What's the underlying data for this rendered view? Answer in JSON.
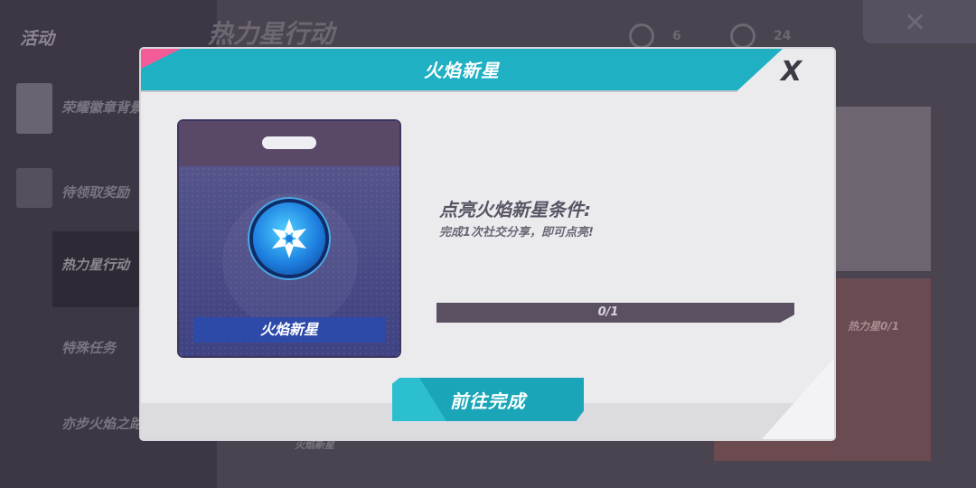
{
  "background": {
    "sidebar_title": "活动",
    "nav_items": [
      {
        "label": "荣耀徽章背景"
      },
      {
        "label": "待领取奖励"
      },
      {
        "label": "热力星行动"
      },
      {
        "label": "特殊任务"
      },
      {
        "label": "亦步火焰之路"
      }
    ],
    "page_title": "热力星行动",
    "resources": [
      {
        "icon": "star-badge-icon",
        "count": "6"
      },
      {
        "icon": "gear-coin-icon",
        "count": "24"
      }
    ],
    "right_progress": "热力星0/1",
    "bottom_label": "火焰新星"
  },
  "modal": {
    "title": "火焰新星",
    "close_label": "X",
    "badge": {
      "name": "火焰新星",
      "icon": "snowflake-medal-icon"
    },
    "condition": {
      "title": "点亮火焰新星条件:",
      "description": "完成1次社交分享，即可点亮!"
    },
    "progress": {
      "text": "0/1",
      "current": 0,
      "total": 1
    },
    "action_button": "前往完成"
  },
  "colors": {
    "accent_cyan": "#1fb0c4",
    "accent_pink": "#f35c96",
    "badge_blue": "#2d4aa8"
  }
}
